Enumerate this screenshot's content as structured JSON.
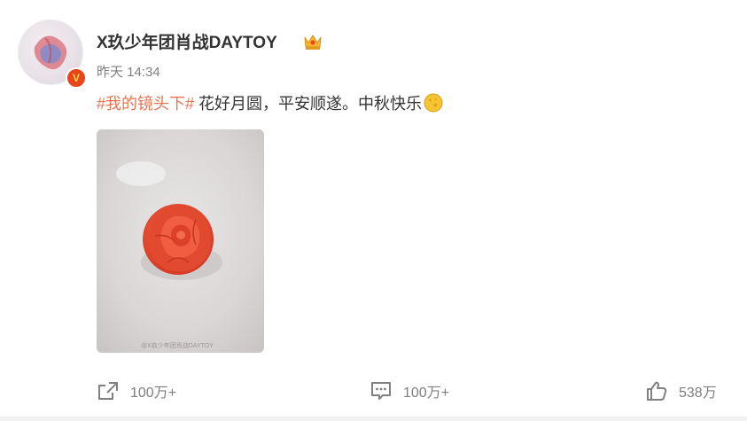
{
  "user": {
    "name": "X玖少年团肖战DAYTOY",
    "verified_badge": "V",
    "avatar_icon": "user-avatar",
    "crown_icon": "crown-icon"
  },
  "post": {
    "timestamp": "昨天 14:34",
    "hashtag": "#我的镜头下#",
    "text": " 花好月圆，平安顺遂。中秋快乐",
    "emoji_icon": "moon-emoji",
    "image_watermark": "@X玖少年团肖战DAYTOY",
    "image_subject": "red-flower-mooncake-on-plate"
  },
  "toolbar": {
    "share_count": "100万+",
    "comment_count": "100万+",
    "like_count": "538万"
  },
  "colors": {
    "hashtag": "#eb7350",
    "verified": "#e8451b",
    "text": "#333333",
    "muted": "#808080"
  }
}
